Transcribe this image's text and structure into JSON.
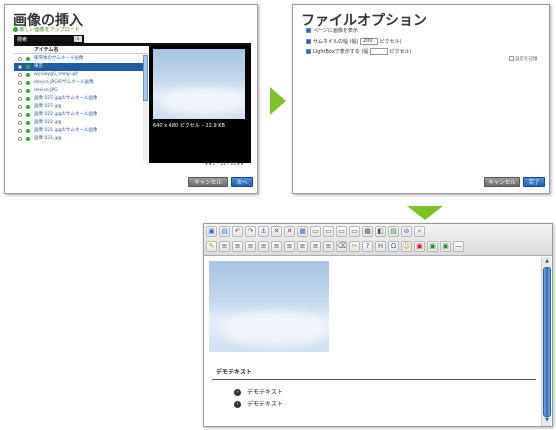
{
  "insert_dialog": {
    "title": "画像の挿入",
    "upload_link": "新しい画像をアップロード",
    "search_text": "検索",
    "column_header": "アイテム名",
    "items": [
      "衝突後のサムネール画像",
      "東京",
      "wysiwyg5_emoji.gif",
      "device.JPGのサムネール画像",
      "device.JPG",
      "画像 027.jpgのサムネール画像",
      "画像 027.jpg",
      "画像 022.jpgのサムネール画像",
      "画像 022.jpg",
      "画像 021.jpgのサムネール画像",
      "画像 021.jpg"
    ],
    "selected_index": 1,
    "preview_caption": "640 x 480 ピクセル – 22.9 KB",
    "pager": "1 – 22 / 22",
    "cancel_label": "キャンセル",
    "next_label": "次へ"
  },
  "options_dialog": {
    "title": "ファイルオプション",
    "option1": "ページに画像を表示",
    "option2_prefix": "サムネイルの幅 (幅)",
    "option2_value": "200",
    "option2_unit": "ピクセル)",
    "option3_prefix": "LightBoxで表示する (幅",
    "option3_value": "",
    "option3_unit": "ピクセル)",
    "remember": "設定を記憶",
    "cancel_label": "キャンセル",
    "done_label": "完了"
  },
  "editor": {
    "heading": "デモテキスト",
    "bullets": [
      "デモテキスト",
      "デモテキスト"
    ]
  },
  "colors": {
    "accent_green": "#7ec22a",
    "selection_blue": "#1f5d9e",
    "link_blue": "#2a5f9a"
  }
}
